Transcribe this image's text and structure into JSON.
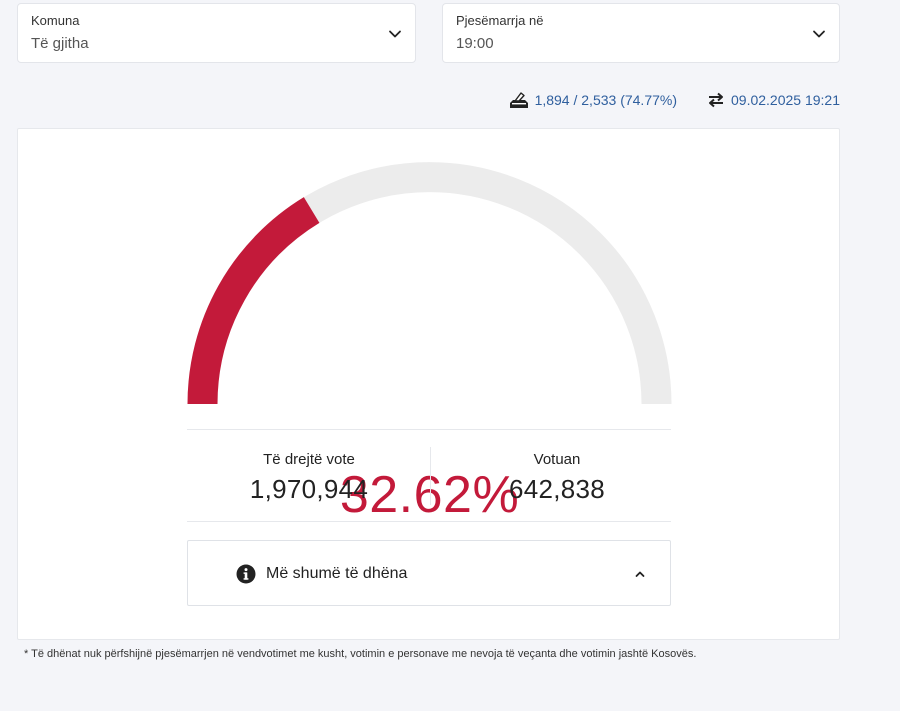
{
  "filters": {
    "komuna": {
      "label": "Komuna",
      "value": "Të gjitha"
    },
    "pjesemarrja": {
      "label": "Pjesëmarrja në",
      "value": "19:00"
    }
  },
  "stats": {
    "stations": "1,894 / 2,533 (74.77%)",
    "updated": "09.02.2025 19:21"
  },
  "gauge": {
    "percent_label": "32.62%",
    "fill_fraction": 0.3262,
    "fill_color": "#c31a3a",
    "track_color": "#ececec"
  },
  "metrics": {
    "eligible": {
      "label": "Të drejtë vote",
      "value": "1,970,944"
    },
    "voted": {
      "label": "Votuan",
      "value": "642,838"
    }
  },
  "more": {
    "label": "Më shumë të dhëna"
  },
  "footnote": "* Të dhënat nuk përfshijnë pjesëmarrjen në vendvotimet me kusht, votimin e personave me nevoja të veçanta dhe votimin jashtë Kosovës."
}
